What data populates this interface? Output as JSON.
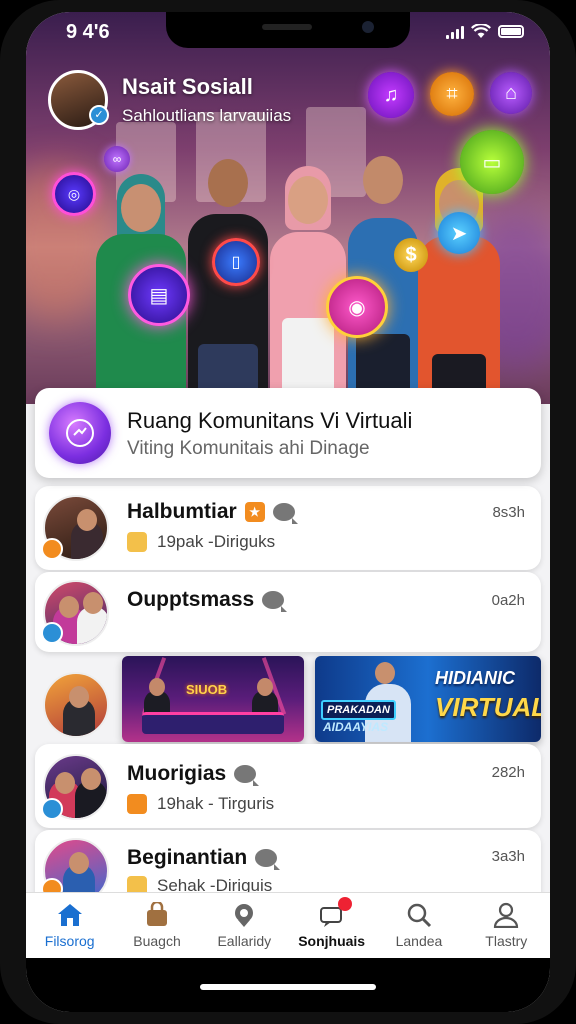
{
  "status": {
    "time": "9 4'6"
  },
  "header": {
    "name": "Nsait Sosiall",
    "subtitle": "Sahloutlians larvauiias"
  },
  "banner": {
    "title": "Ruang Komunitans Vi Virtuali",
    "subtitle": "Viting Komunitais ahi Dinage"
  },
  "rows": [
    {
      "title": "Halbumtiar",
      "sub": "19pak -Diriguks",
      "time": "8s3h"
    },
    {
      "title": "Oupptsmass",
      "sub": "",
      "time": "0a2h"
    },
    {
      "title": "Muorigias",
      "sub": "19hak - Tirguris",
      "time": "282h"
    },
    {
      "title": "Beginantian",
      "sub": "Sehak -Diriguis",
      "time": "3a3h"
    }
  ],
  "promos": {
    "gaming_title": "SIUOB",
    "virtual_line1": "HIDIANIC",
    "virtual_line2": "VIRTUAL",
    "virtual_badge": "PRAKADAN",
    "virtual_caption": "AIDAAYIAS"
  },
  "tabs": [
    {
      "label": "Filsorog",
      "icon": "home-icon",
      "state": "active"
    },
    {
      "label": "Buagch",
      "icon": "bag-icon",
      "state": "normal"
    },
    {
      "label": "Eallaridy",
      "icon": "location-icon",
      "state": "normal"
    },
    {
      "label": "Sonjhuais",
      "icon": "chat-icon",
      "state": "bold"
    },
    {
      "label": "Landea",
      "icon": "search-icon",
      "state": "normal"
    },
    {
      "label": "Tlastry",
      "icon": "profile-icon",
      "state": "normal"
    }
  ],
  "colors": {
    "accent": "#1a6fd0",
    "brand_purple": "#7b2ee0",
    "badge_red": "#e22233"
  }
}
